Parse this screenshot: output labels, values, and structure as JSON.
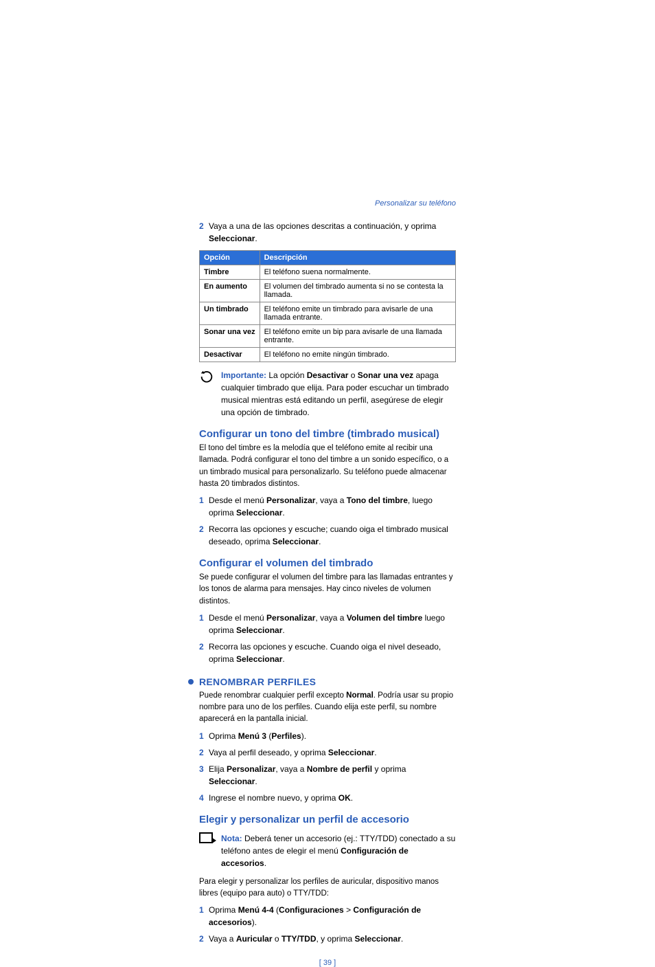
{
  "breadcrumb": "Personalizar su teléfono",
  "intro_step_num": "2",
  "intro_step_a": "Vaya a una de las opciones descritas a continuación, y oprima ",
  "intro_step_b": "Seleccionar",
  "intro_step_c": ".",
  "table": {
    "head_opt": "Opción",
    "head_desc": "Descripción",
    "rows": [
      {
        "opt": "Timbre",
        "desc": "El teléfono suena normalmente."
      },
      {
        "opt": "En aumento",
        "desc": "El volumen del timbrado aumenta si no se contesta la llamada."
      },
      {
        "opt": "Un timbrado",
        "desc": "El teléfono emite un timbrado para avisarle de una llamada entrante."
      },
      {
        "opt": "Sonar una vez",
        "desc": "El teléfono emite un bip para avisarle de una llamada entrante."
      },
      {
        "opt": "Desactivar",
        "desc": "El teléfono no emite ningún timbrado."
      }
    ]
  },
  "important": {
    "label": "Importante: ",
    "a": "La opción ",
    "b": "Desactivar",
    "c": " o ",
    "d": "Sonar una vez",
    "e": " apaga cualquier timbrado que elija. Para poder escuchar un timbrado musical mientras está editando un perfil, asegúrese de elegir una opción de timbrado."
  },
  "sec1": {
    "title": "Configurar un tono del timbre (timbrado musical)",
    "p": "El tono del timbre es la melodía que el teléfono emite al recibir una llamada. Podrá configurar el tono del timbre a un sonido específico, o a un timbrado musical para personalizarlo. Su teléfono puede almacenar hasta 20 timbrados distintos.",
    "s1n": "1",
    "s1a": "Desde el menú ",
    "s1b": "Personalizar",
    "s1c": ", vaya a ",
    "s1d": "Tono del timbre",
    "s1e": ", luego oprima ",
    "s1f": "Seleccionar",
    "s1g": ".",
    "s2n": "2",
    "s2a": "Recorra las opciones y escuche; cuando oiga el timbrado musical deseado, oprima ",
    "s2b": "Seleccionar",
    "s2c": "."
  },
  "sec2": {
    "title": "Configurar el volumen del timbrado",
    "p": "Se puede configurar el volumen del timbre para las llamadas entrantes y los tonos de alarma para mensajes. Hay cinco niveles de volumen distintos.",
    "s1n": "1",
    "s1a": "Desde el menú ",
    "s1b": "Personalizar",
    "s1c": ", vaya a ",
    "s1d": "Volumen del timbre",
    "s1e": " luego oprima ",
    "s1f": "Seleccionar",
    "s1g": ".",
    "s2n": "2",
    "s2a": "Recorra las opciones y escuche. Cuando oiga el nivel deseado, oprima ",
    "s2b": "Seleccionar",
    "s2c": "."
  },
  "sec3": {
    "title": "RENOMBRAR PERFILES",
    "pa": "Puede renombrar cualquier perfil excepto ",
    "pb": "Normal",
    "pc": ". Podría usar su propio nombre para uno de los perfiles. Cuando elija este perfil, su nombre aparecerá en la pantalla inicial.",
    "s1n": "1",
    "s1a": "Oprima ",
    "s1b": "Menú 3",
    "s1c": " (",
    "s1d": "Perfiles",
    "s1e": ").",
    "s2n": "2",
    "s2a": "Vaya al perfil deseado, y oprima ",
    "s2b": "Seleccionar",
    "s2c": ".",
    "s3n": "3",
    "s3a": "Elija ",
    "s3b": "Personalizar",
    "s3c": ", vaya a ",
    "s3d": "Nombre de perfil",
    "s3e": " y oprima ",
    "s3f": "Seleccionar",
    "s3g": ".",
    "s4n": "4",
    "s4a": "Ingrese el nombre nuevo, y oprima ",
    "s4b": "OK",
    "s4c": "."
  },
  "sec4": {
    "title": "Elegir y personalizar un perfil de accesorio",
    "note_label": "Nota: ",
    "note_a": "Deberá tener un accesorio (ej.: TTY/TDD) conectado a su teléfono antes de elegir el menú ",
    "note_b": "Configuración de accesorios",
    "note_c": ".",
    "p": "Para elegir y personalizar los perfiles de auricular, dispositivo manos libres (equipo para auto) o TTY/TDD:",
    "s1n": "1",
    "s1a": "Oprima ",
    "s1b": "Menú 4-4",
    "s1c": " (",
    "s1d": "Configuraciones",
    "s1e": " > ",
    "s1f": "Configuración de accesorios",
    "s1g": ").",
    "s2n": "2",
    "s2a": "Vaya a ",
    "s2b": "Auricular",
    "s2c": " o ",
    "s2d": "TTY/TDD",
    "s2e": ", y oprima ",
    "s2f": "Seleccionar",
    "s2g": "."
  },
  "footer": "[ 39 ]"
}
